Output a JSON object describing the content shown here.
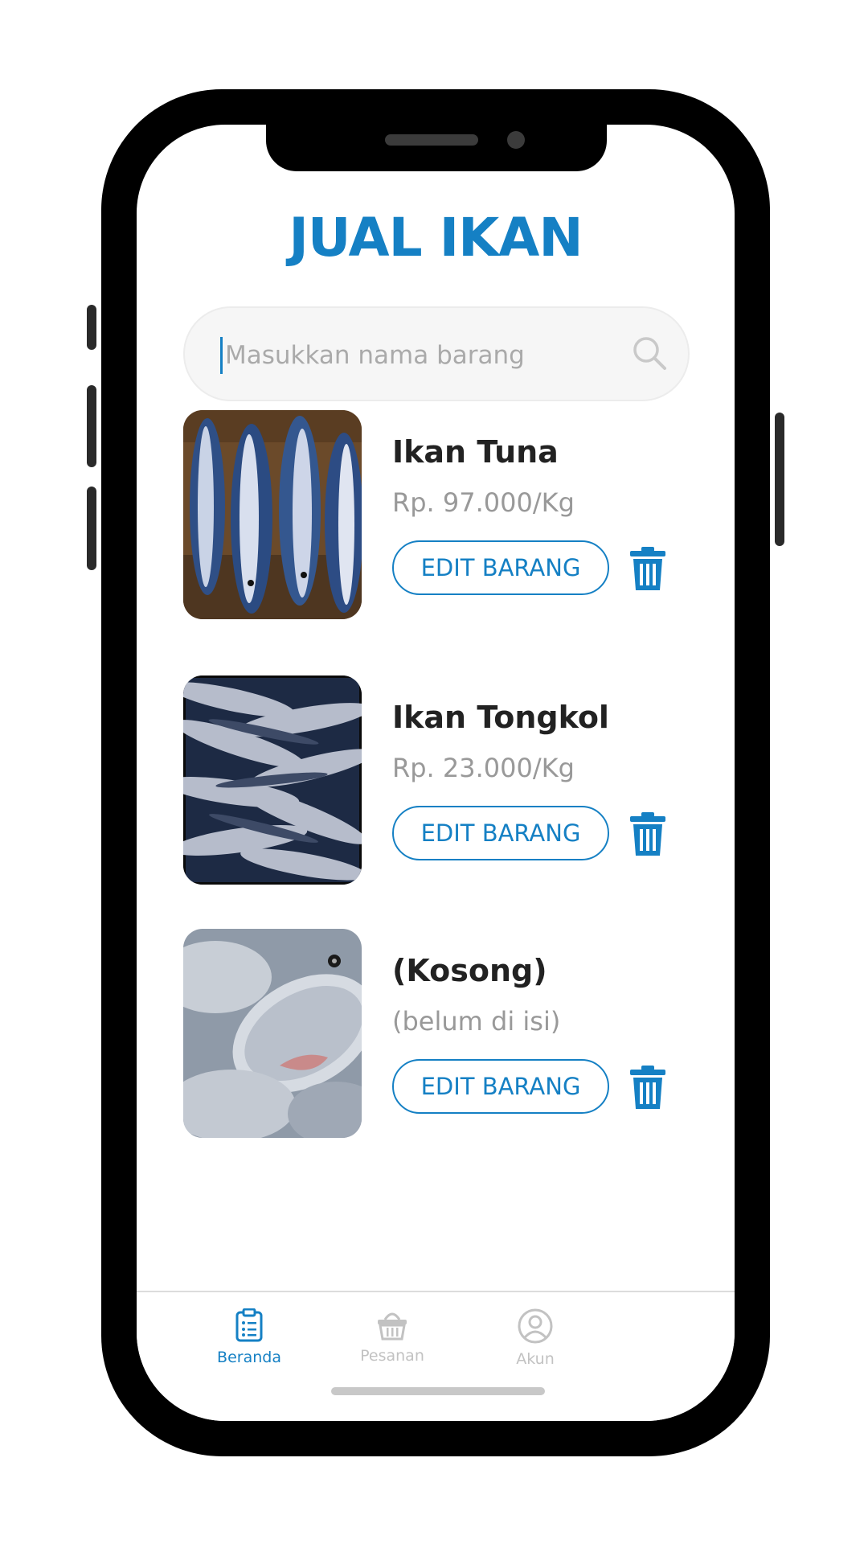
{
  "app": {
    "title": "JUAL IKAN"
  },
  "search": {
    "placeholder": "Masukkan nama barang"
  },
  "items": [
    {
      "name": "Ikan Tuna",
      "price": "Rp. 97.000/Kg",
      "edit_label": "EDIT BARANG"
    },
    {
      "name": "Ikan Tongkol",
      "price": "Rp. 23.000/Kg",
      "edit_label": "EDIT BARANG"
    },
    {
      "name": "(Kosong)",
      "price": "(belum di isi)",
      "edit_label": "EDIT BARANG"
    }
  ],
  "nav": {
    "items": [
      {
        "label": "Beranda",
        "icon": "clipboard-icon",
        "active": true
      },
      {
        "label": "Pesanan",
        "icon": "basket-icon",
        "active": false
      },
      {
        "label": "Akun",
        "icon": "user-icon",
        "active": false
      }
    ]
  },
  "colors": {
    "accent": "#1580c4",
    "inactive": "#c2c2c2"
  }
}
